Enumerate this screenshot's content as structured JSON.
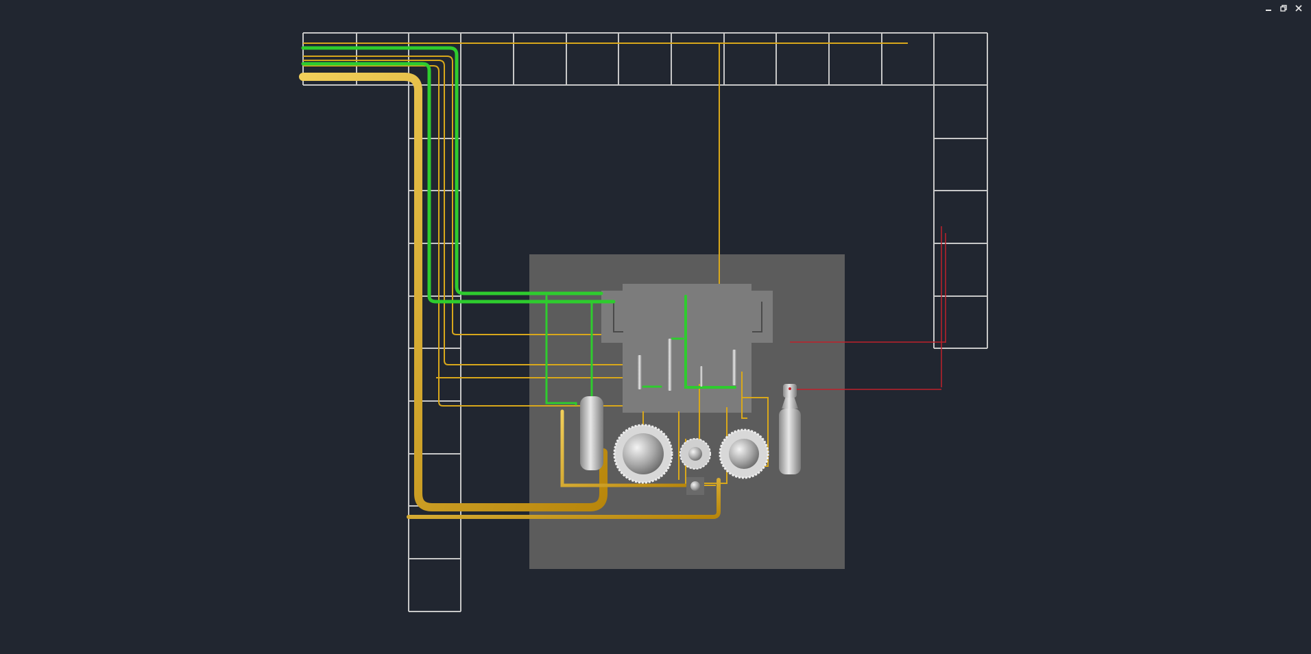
{
  "window": {
    "controls": [
      {
        "name": "minimize-icon"
      },
      {
        "name": "restore-icon"
      },
      {
        "name": "close-icon"
      }
    ]
  },
  "scene": {
    "background": "#212630",
    "grid_color": "#c8c8c8",
    "platform_color": "#5c5c5c",
    "equipment_color": "#7a7a7a",
    "pipe_gold": "#d9a81b",
    "pipe_green": "#2ecc2e",
    "marker_red": "#c0202a"
  }
}
